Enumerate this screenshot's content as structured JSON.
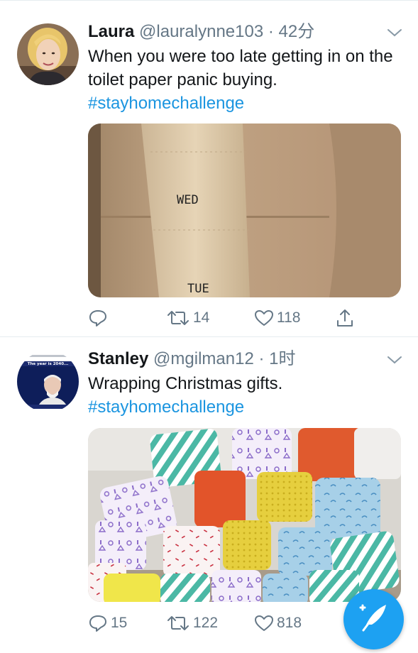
{
  "tweets": [
    {
      "name": "Laura",
      "handle": "@lauralynne103",
      "separator": "·",
      "time": "42分",
      "text": "When you were too late getting in on the toilet paper panic buying.",
      "hashtag": "#stayhomechallenge",
      "media": {
        "roll_text_1": "WED",
        "roll_text_2": "TUE"
      },
      "actions": {
        "reply_count": "",
        "retweet_count": "14",
        "like_count": "118"
      }
    },
    {
      "name": "Stanley",
      "handle": "@mgilman12",
      "separator": "·",
      "time": "1时",
      "text": "Wrapping Christmas gifts.",
      "hashtag": "#stayhomechallenge",
      "avatar_text": "The year is 2040...",
      "actions": {
        "reply_count": "15",
        "retweet_count": "122",
        "like_count": "818"
      }
    }
  ],
  "icons": [
    "chevron-down-icon",
    "reply-icon",
    "retweet-icon",
    "like-icon",
    "share-icon",
    "compose-icon"
  ],
  "colors": {
    "accent": "#1da1f2",
    "hashtag": "#1b95e0",
    "secondary_text": "#657786",
    "divider": "#e6ecf0"
  }
}
